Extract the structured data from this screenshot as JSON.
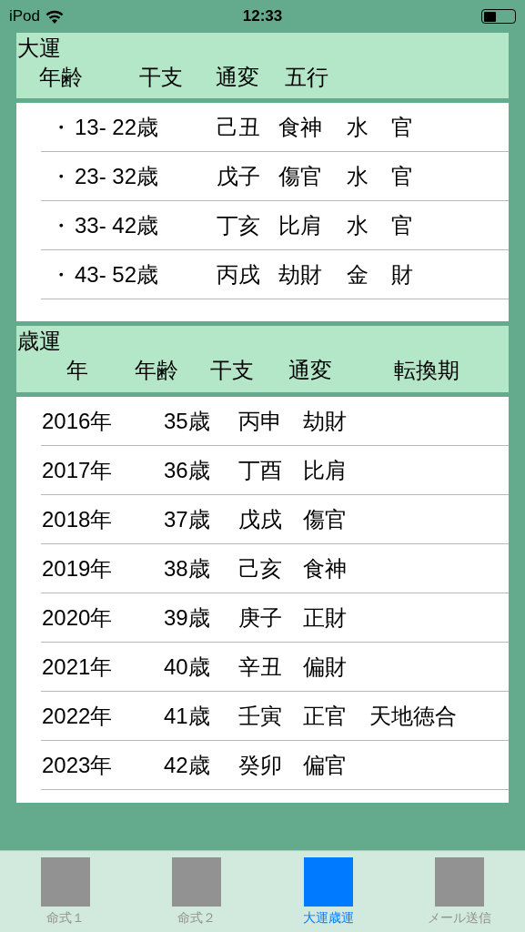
{
  "status_bar": {
    "carrier": "iPod",
    "time": "12:33"
  },
  "daiun": {
    "title": "大運",
    "columns": [
      "年齢",
      "干支",
      "通変",
      "五行"
    ],
    "rows": [
      {
        "bullet": "・",
        "age": "13- 22歳",
        "kanshi": "己丑",
        "tsuhen": "食神",
        "gogyo": "水",
        "star": "官"
      },
      {
        "bullet": "・",
        "age": "23- 32歳",
        "kanshi": "戊子",
        "tsuhen": "傷官",
        "gogyo": "水",
        "star": "官"
      },
      {
        "bullet": "・",
        "age": "33- 42歳",
        "kanshi": "丁亥",
        "tsuhen": "比肩",
        "gogyo": "水",
        "star": "官"
      },
      {
        "bullet": "・",
        "age": "43- 52歳",
        "kanshi": "丙戌",
        "tsuhen": "劫財",
        "gogyo": "金",
        "star": "財"
      }
    ]
  },
  "saiun": {
    "title": "歳運",
    "columns": [
      "年",
      "年齢",
      "干支",
      "通変",
      "転換期"
    ],
    "rows": [
      {
        "year": "2016年",
        "age": "35歳",
        "kanshi": "丙申",
        "tsuhen": "劫財"
      },
      {
        "year": "2017年",
        "age": "36歳",
        "kanshi": "丁酉",
        "tsuhen": "比肩"
      },
      {
        "year": "2018年",
        "age": "37歳",
        "kanshi": "戊戌",
        "tsuhen": "傷官"
      },
      {
        "year": "2019年",
        "age": "38歳",
        "kanshi": "己亥",
        "tsuhen": "食神"
      },
      {
        "year": "2020年",
        "age": "39歳",
        "kanshi": "庚子",
        "tsuhen": "正財"
      },
      {
        "year": "2021年",
        "age": "40歳",
        "kanshi": "辛丑",
        "tsuhen": "偏財"
      },
      {
        "year": "2022年",
        "age": "41歳",
        "kanshi": "壬寅",
        "tsuhen": "正官",
        "turning": "天地徳合"
      },
      {
        "year": "2023年",
        "age": "42歳",
        "kanshi": "癸卯",
        "tsuhen": "偏官"
      }
    ]
  },
  "tab_bar": [
    {
      "label": "命式１",
      "selected": false
    },
    {
      "label": "命式２",
      "selected": false
    },
    {
      "label": "大運歳運",
      "selected": true
    },
    {
      "label": "メール送信",
      "selected": false
    }
  ]
}
